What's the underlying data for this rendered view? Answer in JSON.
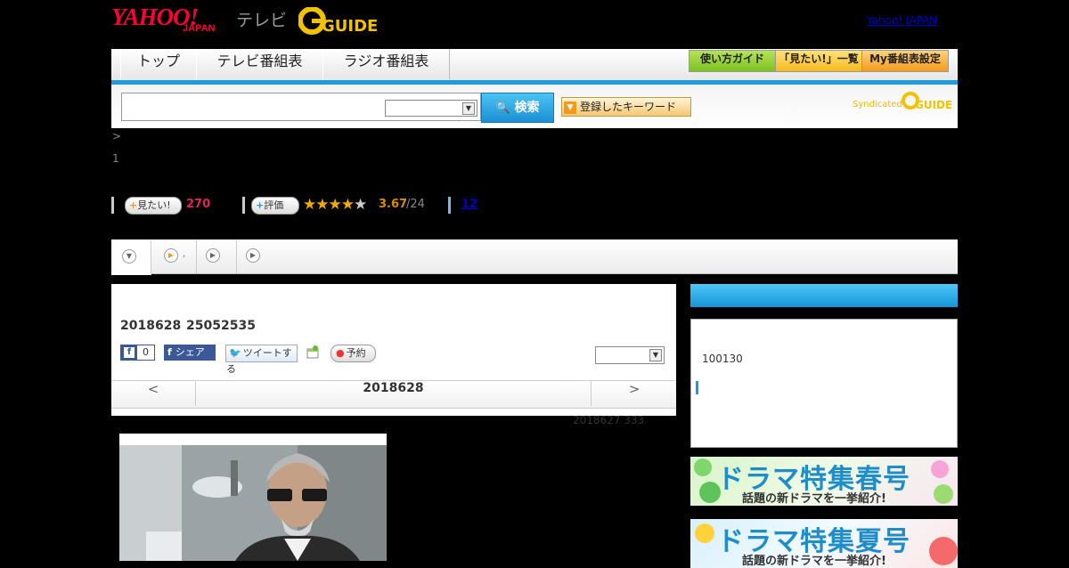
{
  "header": {
    "yahoo_logo": "YAHOO!",
    "japan_logo": "JAPAN",
    "tv_logo": "テレビ",
    "gguide_logo": "G-GUIDE",
    "yahoo_japan_link": "Yahoo! JAPAN"
  },
  "nav": {
    "tabs": [
      "トップ",
      "テレビ番組表",
      "ラジオ番組表"
    ],
    "right_buttons": [
      "使い方ガイド",
      "「見たい!」一覧",
      "My番組表設定"
    ]
  },
  "search": {
    "input_value": "",
    "select_value": "",
    "button_label": "検索",
    "keyword_button": "登録したキーワード",
    "syndicated": "Syndicated"
  },
  "breadcrumb": {
    "arrow": ">",
    "line2": "1"
  },
  "stats": {
    "mitai_label": "見たい!",
    "mitai_count": "270",
    "rate_label": "評価",
    "rating_value": "3.67",
    "rating_count": "/24",
    "review_count": "12",
    "stars_filled": 3.5
  },
  "program": {
    "date": "2018628",
    "time": "25052535",
    "fb_like_count": "0",
    "share_label": "シェア",
    "tweet_label": "ツイートする",
    "reserve_label": "予約",
    "pager_prev": "<",
    "pager_date": "2018628",
    "pager_next": ">",
    "footnote": "2018627 333"
  },
  "sidebar": {
    "box_text": "100130",
    "banners": [
      {
        "title": "ドラマ特集春号",
        "sub": "話題の新ドラマを一挙紹介!"
      },
      {
        "title": "ドラマ特集夏号",
        "sub": "話題の新ドラマを一挙紹介!"
      }
    ]
  },
  "colors": {
    "accent_blue": "#1e9bdc",
    "yahoo_red": "#ff0033",
    "count_pink": "#e0245e",
    "rating_orange": "#e08a00",
    "green_btn": "#8ccd2d",
    "orange_btn": "#f7b52c"
  }
}
